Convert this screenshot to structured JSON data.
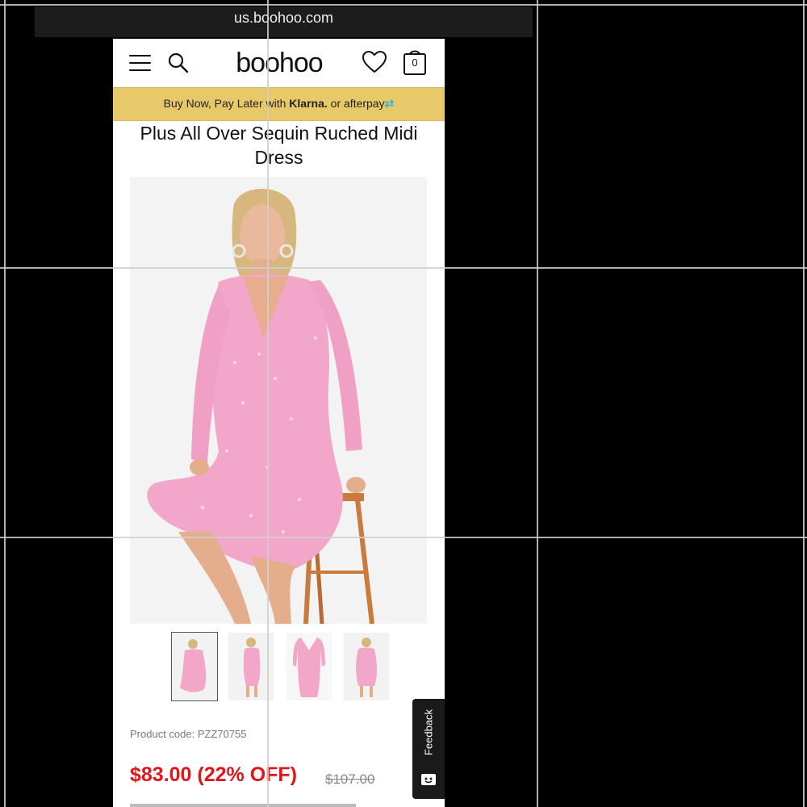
{
  "browser": {
    "url": "us.boohoo.com"
  },
  "header": {
    "logo": "boohoo",
    "bag_count": "0",
    "icons": [
      "hamburger-menu-icon",
      "search-icon",
      "heart-icon",
      "shopping-bag-icon"
    ]
  },
  "banner": {
    "text": "Buy Now, Pay Later with",
    "klarna": "Klarna.",
    "or": "or",
    "afterpay": "afterpay",
    "color": "#e8c96a"
  },
  "product": {
    "title": "Plus All Over Sequin Ruched Midi Dress",
    "code": "Product code: PZZ70755",
    "price": "$83.00 (22% OFF)",
    "was_price": "$107.00",
    "price_color": "#e0161b",
    "thumbnail_count": 4,
    "dress_color": "#f2a6c8"
  },
  "feedback": {
    "label": "Feedback"
  }
}
